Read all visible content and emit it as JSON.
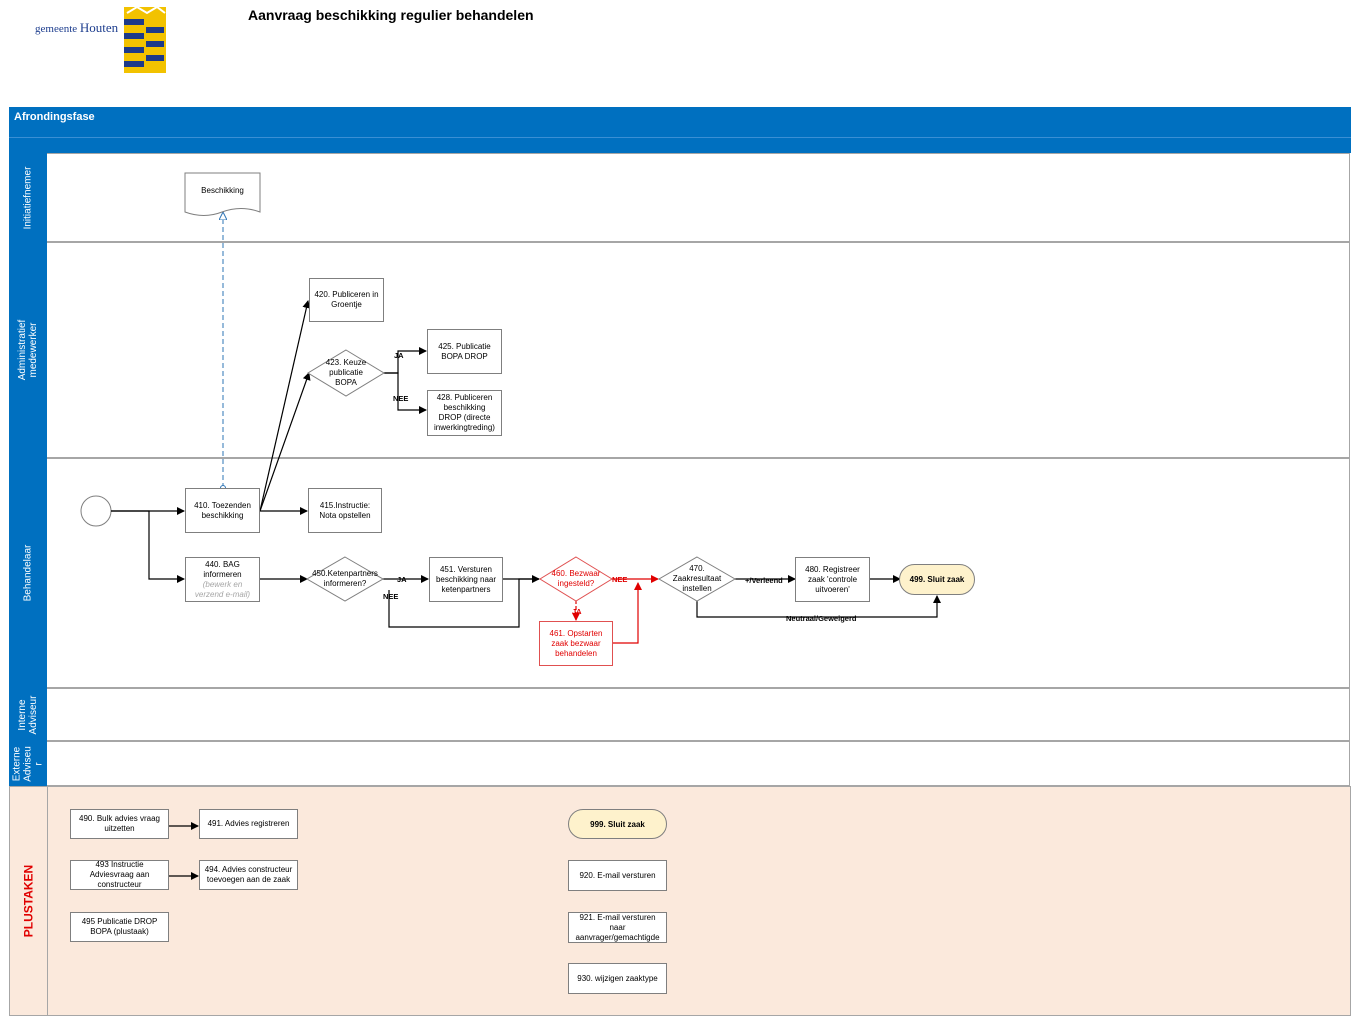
{
  "header": {
    "title": "Aanvraag beschikking regulier behandelen",
    "logo_text_small": "gemeente",
    "logo_text_big": "Houten"
  },
  "phase": {
    "title": "Afrondingsfase"
  },
  "lanes": {
    "initiatiefnemer": "Initiatiefnemer",
    "administratief": "Administratief medewerker",
    "behandelaar": "Behandelaar",
    "interne": "Interne Adviseur",
    "externe": "Externe Adviseu r",
    "plustaken": "PLUSTAKEN"
  },
  "nodes": {
    "beschikking": "Beschikking",
    "n420": "420. Publiceren in Groentje",
    "n423": "423. Keuze publicatie BOPA",
    "n425": "425. Publicatie BOPA DROP",
    "n428": "428. Publiceren beschikking DROP (directe inwerkingtreding)",
    "n410": "410. Toezenden beschikking",
    "n415": "415.Instructie:  Nota opstellen",
    "n440": "440. BAG informeren",
    "n440_sub": "(bewerk en verzend e-mail)",
    "n450": "450.Ketenpartners informeren?",
    "n451": "451. Versturen beschikking naar ketenpartners",
    "n460": "460. Bezwaar ingesteld?",
    "n461": "461. Opstarten zaak bezwaar behandelen",
    "n470": "470. Zaakresultaat instellen",
    "n480": "480. Registreer zaak 'controle uitvoeren'",
    "n499": "499. Sluit zaak"
  },
  "edge_labels": {
    "ja_423": "JA",
    "nee_423": "NEE",
    "ja_450": "JA",
    "nee_450": "NEE",
    "nee_460": "NEE",
    "ja_460": "JA",
    "verleend": "+/Verleend",
    "neutraal": "Neutraal/Geweigerd"
  },
  "plustaken": {
    "p490": "490. Bulk advies vraag uitzetten",
    "p491": "491. Advies registreren",
    "p493": "493 Instructie Adviesvraag aan constructeur",
    "p494": "494. Advies constructeur toevoegen aan de zaak",
    "p495": "495 Publicatie DROP BOPA (plustaak)",
    "p999": "999. Sluit zaak",
    "p920": "920. E-mail versturen",
    "p921": "921. E-mail versturen naar aanvrager/gemachtigde",
    "p930": "930. wijzigen zaaktype"
  },
  "colors": {
    "lane_blue": "#0070c0",
    "plus_bg": "#fbe9dc",
    "terminal_fill": "#fef2cc",
    "red_path": "#e00000"
  }
}
